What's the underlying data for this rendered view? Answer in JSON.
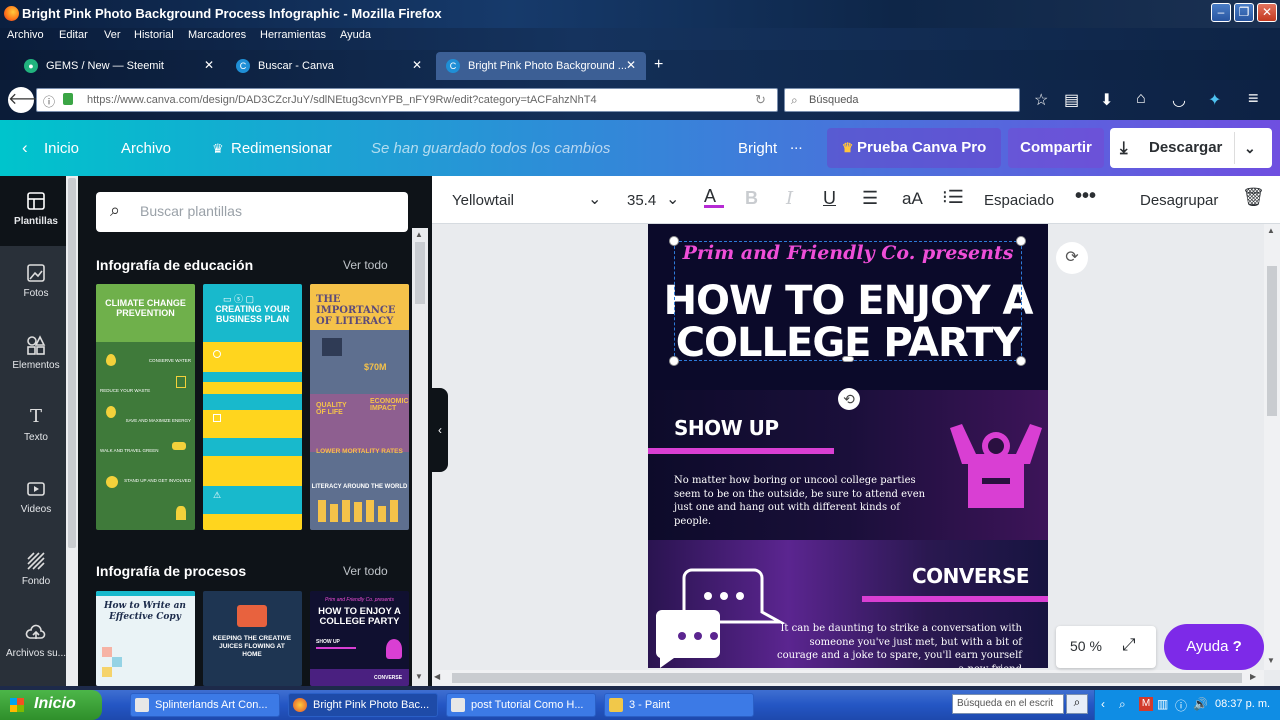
{
  "window": {
    "title": "Bright Pink Photo Background Process Infographic - Mozilla Firefox"
  },
  "menu": [
    "Archivo",
    "Editar",
    "Ver",
    "Historial",
    "Marcadores",
    "Herramientas",
    "Ayuda"
  ],
  "tabs": [
    {
      "label": "GEMS / New — Steemit"
    },
    {
      "label": "Buscar - Canva"
    },
    {
      "label": "Bright Pink Photo Background ..."
    }
  ],
  "nav": {
    "url": "https://www.canva.com/design/DAD3CZcrJuY/sdlNEtug3cvnYPB_nFY9Rw/edit?category=tACFahzNhT4",
    "search_placeholder": "Búsqueda"
  },
  "canva_header": {
    "inicio": "Inicio",
    "archivo": "Archivo",
    "redimensionar": "Redimensionar",
    "saved": "Se han guardado todos los cambios",
    "title": "Bright",
    "pro": "Prueba Canva Pro",
    "share": "Compartir",
    "download": "Descargar"
  },
  "rail": [
    {
      "label": "Plantillas",
      "icon": "layout-icon"
    },
    {
      "label": "Fotos",
      "icon": "image-icon"
    },
    {
      "label": "Elementos",
      "icon": "shapes-icon"
    },
    {
      "label": "Texto",
      "icon": "text-icon"
    },
    {
      "label": "Videos",
      "icon": "video-icon"
    },
    {
      "label": "Fondo",
      "icon": "background-icon"
    },
    {
      "label": "Archivos su...",
      "icon": "upload-icon"
    }
  ],
  "panel": {
    "search_placeholder": "Buscar plantillas",
    "sections": [
      {
        "title": "Infografía de educación",
        "link": "Ver todo"
      },
      {
        "title": "Infografía de procesos",
        "link": "Ver todo"
      }
    ],
    "edu_thumbs": [
      {
        "title": "CLIMATE CHANGE PREVENTION",
        "color": "#6fb04b",
        "items": [
          "CONSERVE WATER",
          "REDUCE YOUR WASTE",
          "SAVE AND MAXIMIZE ENERGY",
          "WALK AND TRAVEL GREEN",
          "STAND UP AND GET INVOLVED"
        ]
      },
      {
        "title": "CREATING YOUR BUSINESS PLAN",
        "color": "#18b9cc"
      },
      {
        "title": "THE IMPORTANCE OF LITERACY",
        "color": "#5e6f8f",
        "items": [
          "$70M",
          "QUALITY OF LIFE",
          "ECONOMIC IMPACT",
          "LOWER MORTALITY RATES",
          "LITERACY AROUND THE WORLD"
        ]
      }
    ],
    "proc_thumbs": [
      {
        "title": "How to Write an Effective Copy"
      },
      {
        "title": "KEEPING THE CREATIVE JUICES FLOWING AT HOME"
      },
      {
        "title": "HOW TO ENJOY A COLLEGE PARTY",
        "sub": "Prim and Friendly Co. presents",
        "items": [
          "SHOW UP",
          "CONVERSE"
        ]
      }
    ]
  },
  "toolbar": {
    "font": "Yellowtail",
    "size": "35.4",
    "spacing": "Espaciado",
    "ungroup": "Desagrupar"
  },
  "design": {
    "script": "Prim and Friendly Co. presents",
    "heading_l1": "HOW TO ENJOY A",
    "heading_l2": "COLLEGE PARTY",
    "s1_title": "SHOW UP",
    "s1_body": "No matter how boring or uncool college parties seem to be on the outside, be sure to attend even just one and hang out with different kinds of people.",
    "s2_title": "CONVERSE",
    "s2_body": "It can be daunting to strike a conversation with someone you've just met, but with a bit of courage and a joke to spare, you'll earn yourself a new friend",
    "accent": "#d93fd3"
  },
  "zoom": "50 %",
  "help": "Ayuda",
  "taskbar": {
    "start": "Inicio",
    "tasks": [
      "Splinterlands Art Con...",
      "Bright Pink Photo Bac...",
      "post Tutorial Como H...",
      "3 - Paint"
    ],
    "search": "Búsqueda en el escrit",
    "time": "08:37 p. m."
  }
}
